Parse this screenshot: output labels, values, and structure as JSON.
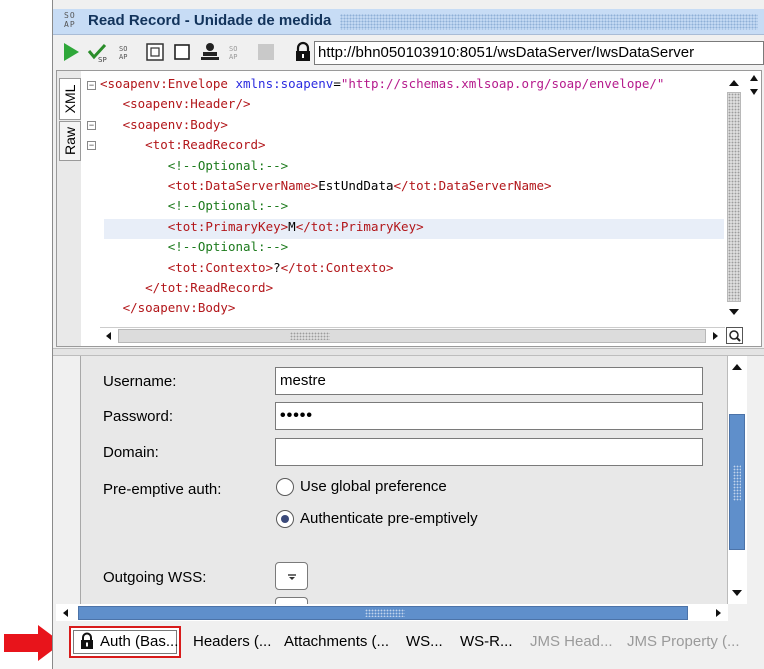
{
  "window": {
    "logo_text": "SO\nAP",
    "title": "Read Record - Unidade de medida"
  },
  "toolbar": {
    "url": "http://bhn050103910:8051/wsDataServer/IwsDataServer",
    "icons": [
      "play-icon",
      "check-green-icon",
      "soap-small-icon",
      "expand-window-icon",
      "window-icon",
      "user-icon",
      "soap-gray-icon",
      "stop-icon",
      "lock-icon"
    ]
  },
  "editor": {
    "tabs": [
      {
        "label": "XML"
      },
      {
        "label": "Raw"
      }
    ],
    "lines": [
      {
        "parts": [
          {
            "c": "tag",
            "t": "<soapenv:Envelope "
          },
          {
            "c": "attr",
            "t": "xmlns:soapenv"
          },
          {
            "c": "txt",
            "t": "="
          },
          {
            "c": "attrv",
            "t": "\"http://schemas.xmlsoap.org/soap/envelope/\""
          }
        ]
      },
      {
        "parts": [
          {
            "c": "txt",
            "t": "   "
          },
          {
            "c": "tag",
            "t": "<soapenv:Header/>"
          }
        ]
      },
      {
        "parts": [
          {
            "c": "txt",
            "t": "   "
          },
          {
            "c": "tag",
            "t": "<soapenv:Body>"
          }
        ]
      },
      {
        "parts": [
          {
            "c": "txt",
            "t": "      "
          },
          {
            "c": "tag",
            "t": "<tot:ReadRecord>"
          }
        ]
      },
      {
        "parts": [
          {
            "c": "txt",
            "t": "         "
          },
          {
            "c": "comm",
            "t": "<!--Optional:-->"
          }
        ]
      },
      {
        "parts": [
          {
            "c": "txt",
            "t": "         "
          },
          {
            "c": "tag",
            "t": "<tot:DataServerName>"
          },
          {
            "c": "txt",
            "t": "EstUndData"
          },
          {
            "c": "tag",
            "t": "</tot:DataServerName>"
          }
        ]
      },
      {
        "parts": [
          {
            "c": "txt",
            "t": "         "
          },
          {
            "c": "comm",
            "t": "<!--Optional:-->"
          }
        ]
      },
      {
        "parts": [
          {
            "c": "txt",
            "t": "         "
          },
          {
            "c": "tag",
            "t": "<tot:PrimaryKey>"
          },
          {
            "c": "txt",
            "t": "M"
          },
          {
            "c": "tag",
            "t": "</tot:PrimaryKey>"
          }
        ]
      },
      {
        "parts": [
          {
            "c": "txt",
            "t": "         "
          },
          {
            "c": "comm",
            "t": "<!--Optional:-->"
          }
        ]
      },
      {
        "parts": [
          {
            "c": "txt",
            "t": "         "
          },
          {
            "c": "tag",
            "t": "<tot:Contexto>"
          },
          {
            "c": "txt",
            "t": "?"
          },
          {
            "c": "tag",
            "t": "</tot:Contexto>"
          }
        ]
      },
      {
        "parts": [
          {
            "c": "txt",
            "t": "      "
          },
          {
            "c": "tag",
            "t": "</tot:ReadRecord>"
          }
        ]
      },
      {
        "parts": [
          {
            "c": "txt",
            "t": "   "
          },
          {
            "c": "tag",
            "t": "</soapenv:Body>"
          }
        ]
      }
    ]
  },
  "auth": {
    "username_label": "Username:",
    "username_value": "mestre",
    "password_label": "Password:",
    "password_value": "•••••",
    "domain_label": "Domain:",
    "domain_value": "",
    "preemptive_label": "Pre-emptive auth:",
    "option_global": "Use global preference",
    "option_preemptive": "Authenticate pre-emptively",
    "selected_option": "Authenticate pre-emptively",
    "wss_label": "Outgoing WSS:"
  },
  "bottom_tabs": [
    {
      "label": "Auth (Bas...",
      "active": true,
      "disabled": false
    },
    {
      "label": "Headers (...",
      "active": false,
      "disabled": false
    },
    {
      "label": "Attachments (...",
      "active": false,
      "disabled": false
    },
    {
      "label": "WS...",
      "active": false,
      "disabled": false
    },
    {
      "label": "WS-R...",
      "active": false,
      "disabled": false
    },
    {
      "label": "JMS Head...",
      "active": false,
      "disabled": true
    },
    {
      "label": "JMS Property (...",
      "active": false,
      "disabled": true
    }
  ],
  "colors": {
    "highlight_arrow": "#e8141b",
    "highlight_box": "#d81b1b",
    "title_bar": "#c7dcf5",
    "scroll_thumb": "#5f8fcb"
  }
}
